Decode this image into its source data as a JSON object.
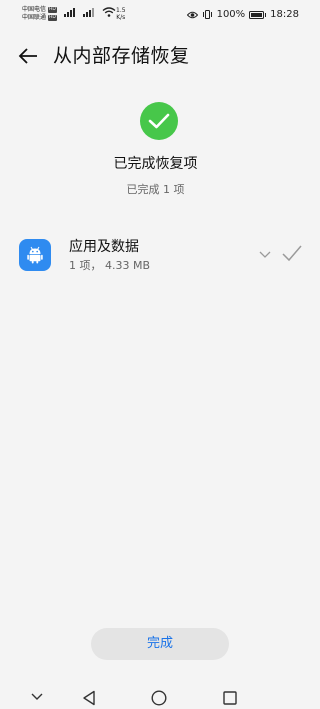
{
  "status_bar": {
    "carrier_1": "中国电信",
    "carrier_2": "中国联通",
    "hd_label": "HD",
    "net_speed_value": "1.5",
    "net_speed_unit": "K/s",
    "battery_percent": "100%",
    "time": "18:28"
  },
  "header": {
    "title": "从内部存储恢复"
  },
  "summary": {
    "title": "已完成恢复项",
    "subtitle": "已完成 1 项"
  },
  "items": [
    {
      "name": "应用及数据",
      "detail": "1 项， 4.33 MB"
    }
  ],
  "footer": {
    "done_label": "完成"
  },
  "colors": {
    "success_green": "#47c74a",
    "accent_blue": "#1a73e8",
    "app_icon_blue": "#2f8bf0"
  }
}
